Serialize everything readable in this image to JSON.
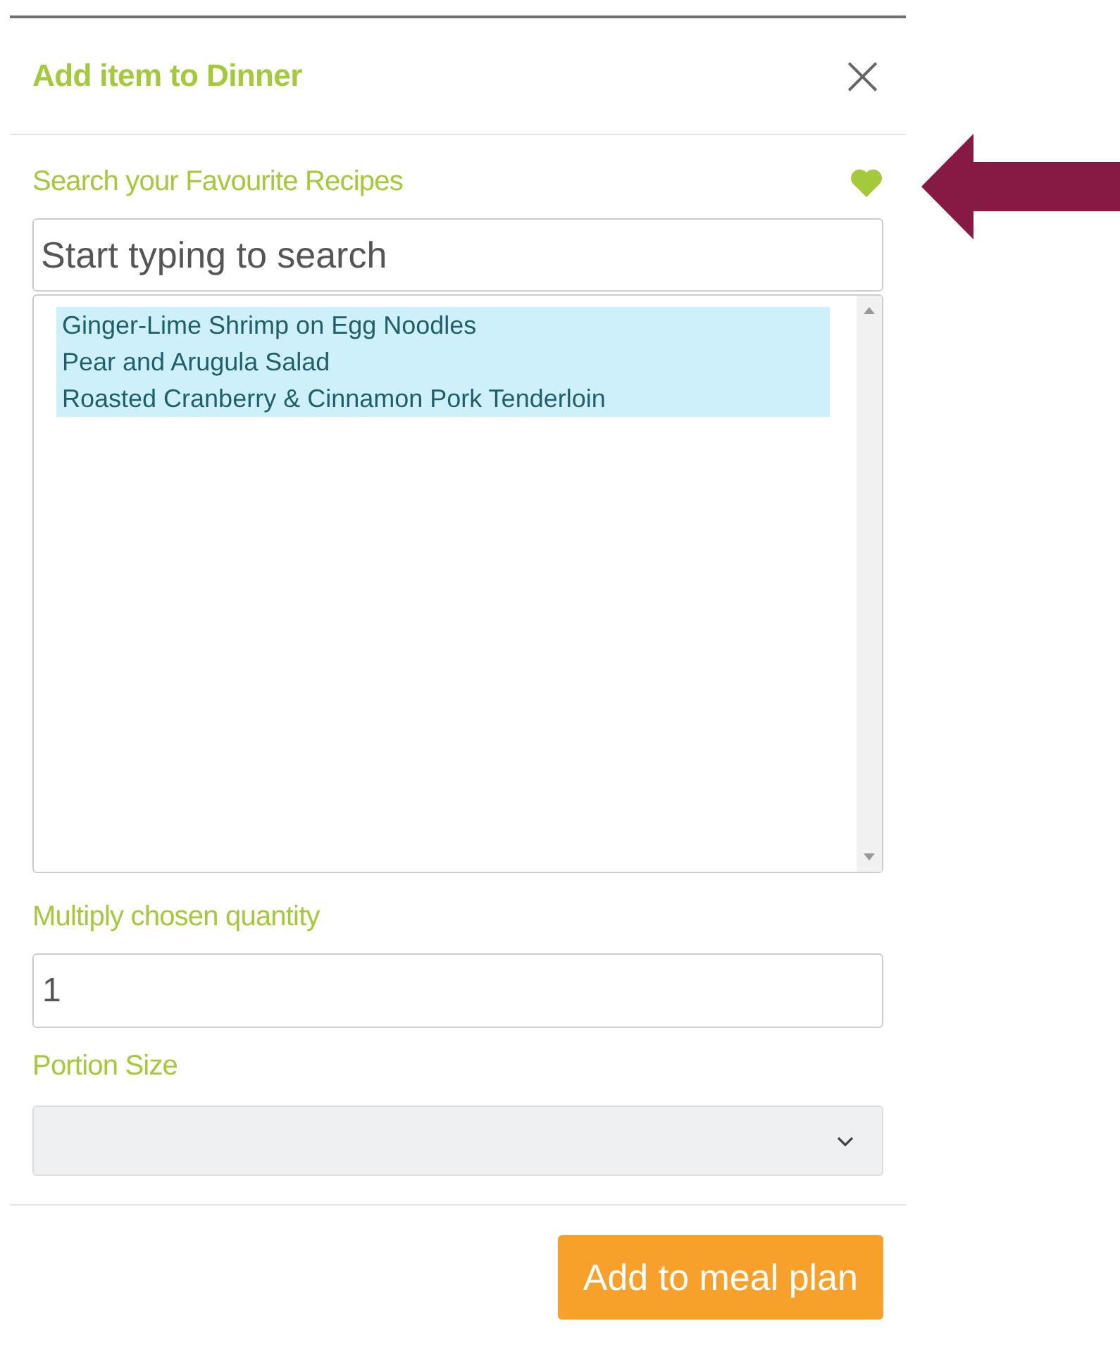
{
  "dialog": {
    "title": "Add item to Dinner",
    "close": "×"
  },
  "search": {
    "label": "Search your Favourite Recipes",
    "placeholder": "Start typing to search"
  },
  "recipes": [
    {
      "name": "Ginger-Lime Shrimp on Egg Noodles",
      "selected": true
    },
    {
      "name": "Pear and Arugula Salad",
      "selected": true
    },
    {
      "name": "Roasted Cranberry & Cinnamon Pork Tenderloin",
      "selected": true
    }
  ],
  "quantity": {
    "label": "Multiply chosen quantity",
    "value": "1"
  },
  "portion": {
    "label": "Portion Size",
    "disabled": true
  },
  "buttons": [
    "Add to meal plan"
  ]
}
